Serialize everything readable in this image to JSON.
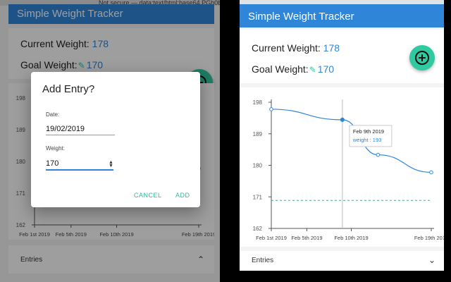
{
  "app": {
    "title": "Simple Weight Tracker"
  },
  "browser": {
    "url_fragment": "Not secure — data:text/html;base64,PGh0bWwgbGFuZz0iZW4iPjxoZWFk"
  },
  "summary": {
    "current_label": "Current Weight:",
    "current_value": "178",
    "goal_label": "Goal Weight:",
    "goal_value": "170"
  },
  "dialog": {
    "title": "Add Entry?",
    "date_label": "Date:",
    "date_value": "19/02/2019",
    "weight_label": "Weight:",
    "weight_value": "170",
    "cancel": "CANCEL",
    "add": "ADD"
  },
  "entries": {
    "label": "Entries"
  },
  "tooltip": {
    "title": "Feb 9th 2019",
    "series": "weight",
    "value": "193"
  },
  "icons": {
    "fab": "add-circle-icon",
    "edit": "pencil-icon",
    "expand": "chevron-icon"
  },
  "colors": {
    "primary": "#2f86d8",
    "accent": "#2fc9a2",
    "goal_line": "#2fb5a0"
  },
  "chart_data": {
    "type": "line",
    "x_ticks": [
      "Feb 1st 2019",
      "Feb 5th 2019",
      "Feb 10th 2019",
      "Feb 19th 2019"
    ],
    "x_tick_days": [
      1,
      5,
      10,
      19
    ],
    "y_ticks": [
      162,
      171,
      180,
      189,
      198
    ],
    "ylim": [
      162,
      198
    ],
    "xlim": [
      1,
      19
    ],
    "series": [
      {
        "name": "weight",
        "x": [
          1,
          9,
          13,
          19
        ],
        "values": [
          196,
          193,
          183,
          178
        ]
      }
    ],
    "goal_line": 170,
    "highlight_x": 9
  }
}
